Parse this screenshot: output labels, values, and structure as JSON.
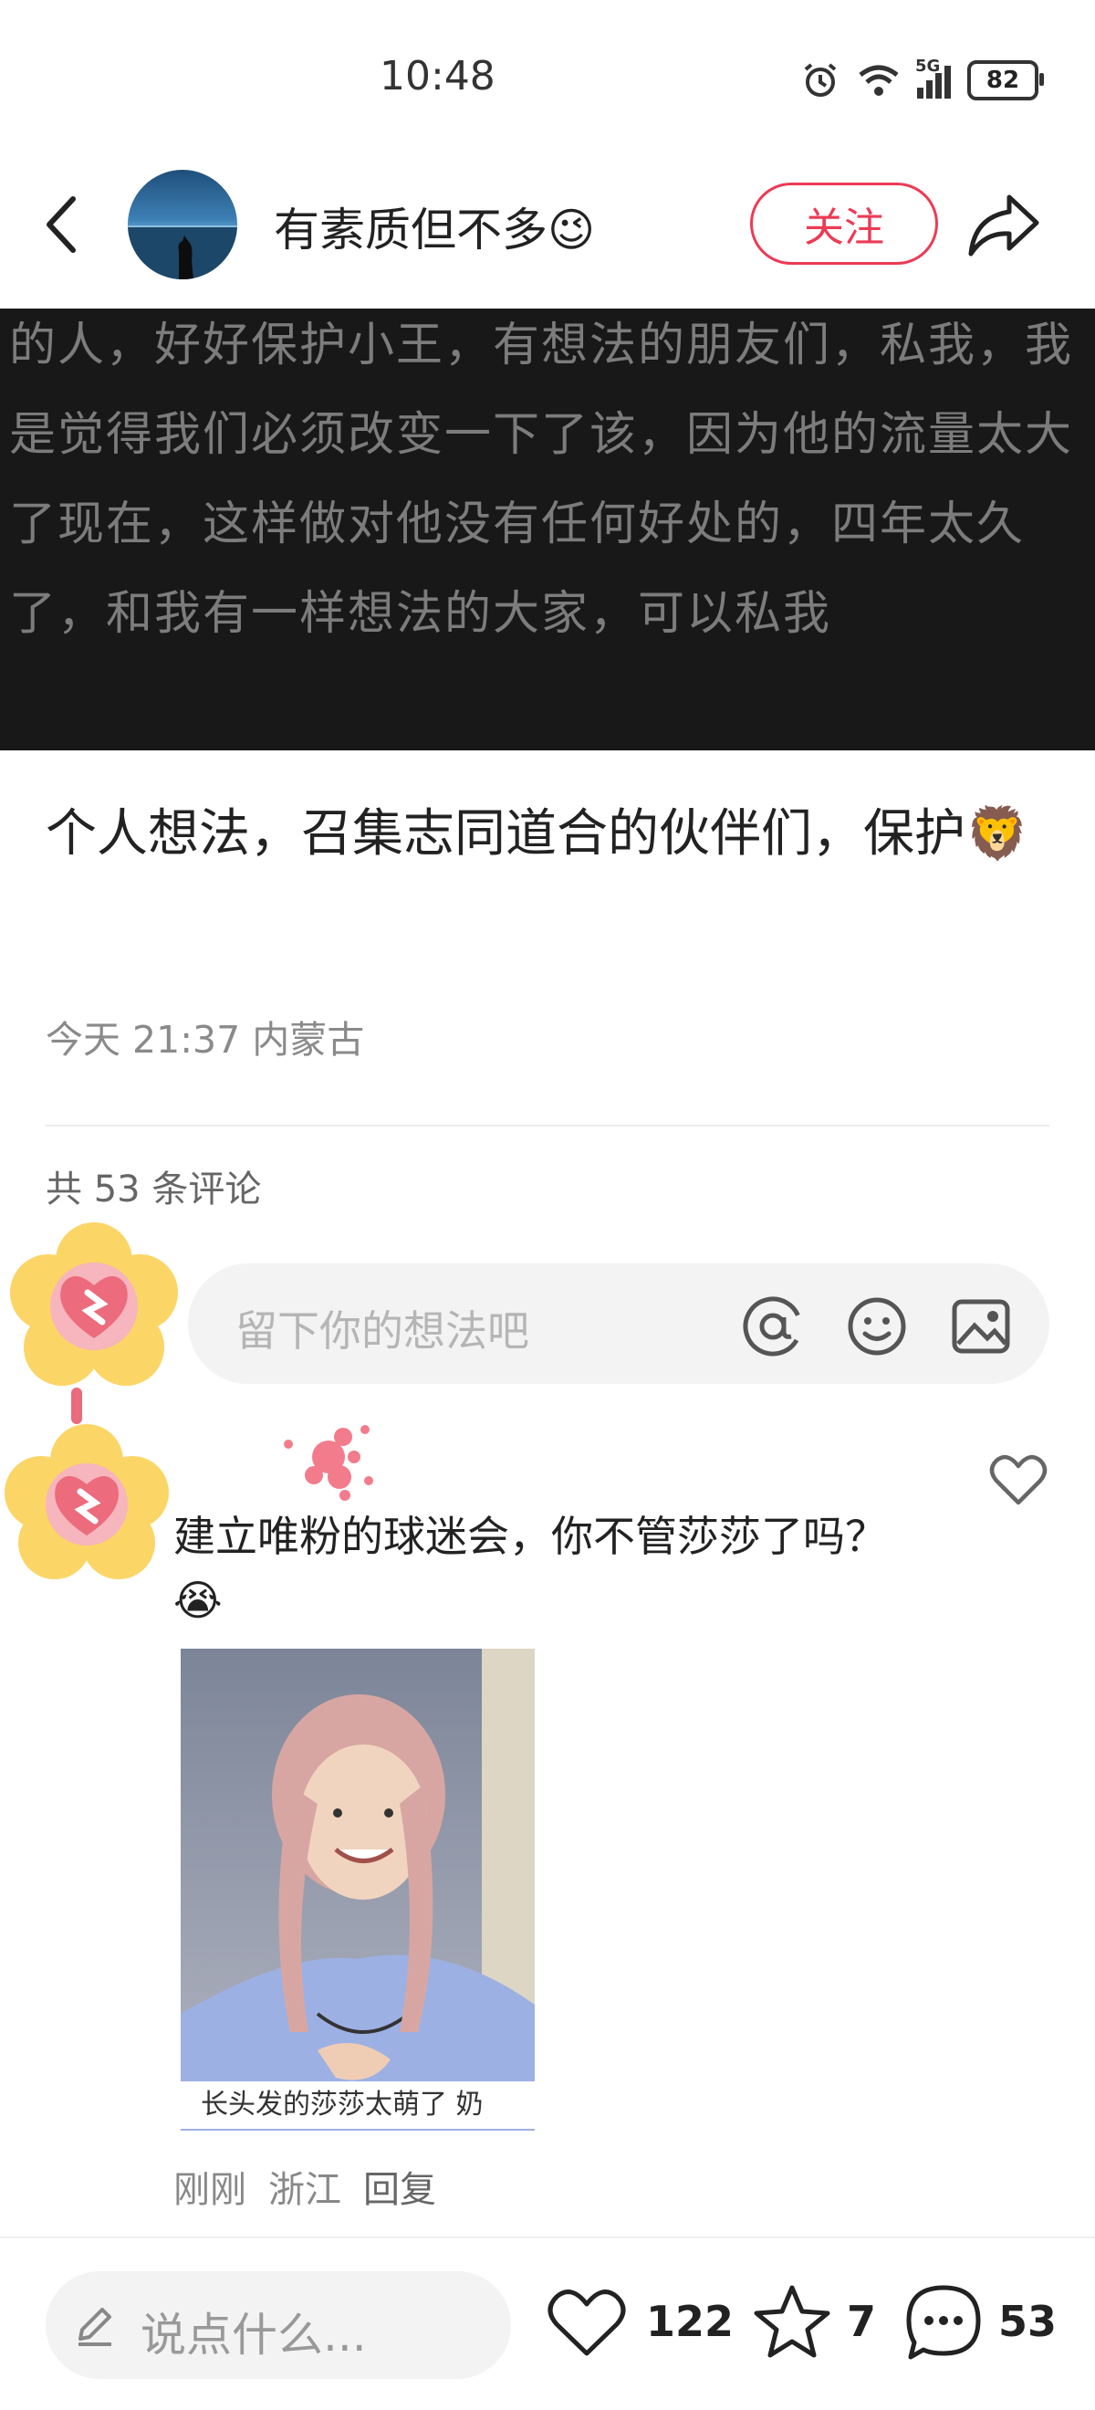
{
  "status_bar": {
    "time": "10:48",
    "battery": "82",
    "signal_label": "5G"
  },
  "header": {
    "username": "有素质但不多😉",
    "follow_label": "关注"
  },
  "image_text": "的人，好好保护小王，有想法的朋友们，私我，我是觉得我们必须改变一下了该，因为他的流量太大了现在，这样做对他没有任何好处的，四年太久了，和我有一样想法的大家，可以私我",
  "post": {
    "title": "个人想法，召集志同道合的伙伴们，保护🦁",
    "meta": "今天 21:37 内蒙古"
  },
  "comments": {
    "count_label": "共 53 条评论",
    "input_placeholder": "留下你的想法吧",
    "items": [
      {
        "text": "建立唯粉的球迷会，你不管莎莎了吗？😭",
        "image_caption": "长头发的莎莎太萌了 奶",
        "time": "刚刚",
        "location": "浙江",
        "reply_label": "回复"
      }
    ]
  },
  "bottom_bar": {
    "input_placeholder": "说点什么...",
    "likes": "122",
    "favorites": "7",
    "comments": "53"
  },
  "colors": {
    "accent": "#ec3b55",
    "badge_yellow": "#fbd566",
    "badge_pink": "#f07585"
  },
  "icons": [
    "back-arrow-icon",
    "share-icon",
    "at-icon",
    "emoji-icon",
    "image-icon",
    "heart-icon",
    "pencil-icon",
    "star-icon",
    "comment-bubble-icon",
    "alarm-icon",
    "wifi-icon",
    "signal-icon"
  ]
}
